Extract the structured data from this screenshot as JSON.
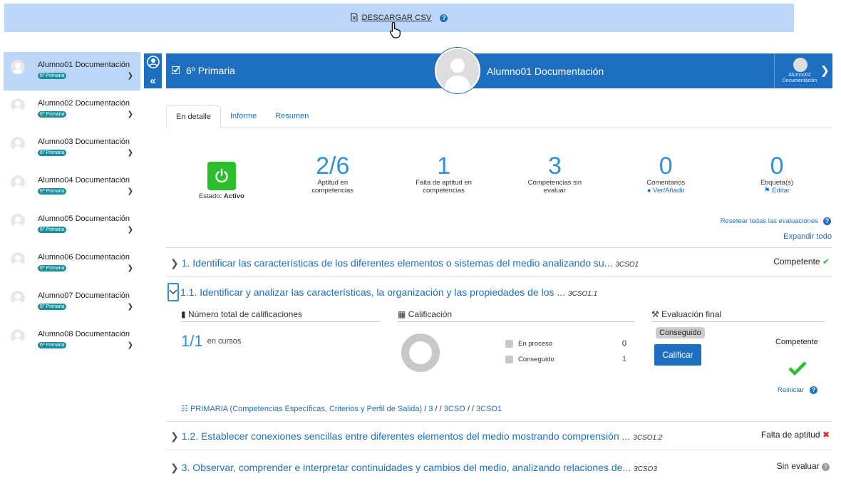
{
  "top": {
    "download_label": "DESCARGAR CSV"
  },
  "sidebar": {
    "items": [
      {
        "name": "Alumno01 Documentación",
        "badge": "6º Primaria"
      },
      {
        "name": "Alumno02 Documentación",
        "badge": "6º Primaria"
      },
      {
        "name": "Alumno03 Documentación",
        "badge": "6º Primaria"
      },
      {
        "name": "Alumno04 Documentación",
        "badge": "6º Primaria"
      },
      {
        "name": "Alumno05 Documentación",
        "badge": "6º Primaria"
      },
      {
        "name": "Alumno06 Documentación",
        "badge": "6º Primaria"
      },
      {
        "name": "Alumno07 Documentación",
        "badge": "6º Primaria"
      },
      {
        "name": "Alumno08 Documentación",
        "badge": "6º Primaria"
      }
    ]
  },
  "header": {
    "course": "6º Primaria",
    "student": "Alumno01 Documentación",
    "next_student_line1": "Alumno02",
    "next_student_line2": "Documentación"
  },
  "tabs": [
    "En detalle",
    "Informe",
    "Resumen"
  ],
  "stats": {
    "state_label": "Estado:",
    "state_value": "Activo",
    "aptitude_value": "2/6",
    "aptitude_label": "Aptitud en competencias",
    "lack_value": "1",
    "lack_label": "Falta de aptitud en competencias",
    "uneval_value": "3",
    "uneval_label": "Competencias sin evaluar",
    "comments_value": "0",
    "comments_label": "Comentarios",
    "comments_link": "Ver/Añadir",
    "tags_value": "0",
    "tags_label": "Etiqueta(s)",
    "tags_link": "Editar"
  },
  "actions": {
    "reset_all": "Resetear todas las evaluaciones",
    "expand_all": "Expandir todo"
  },
  "competencies": [
    {
      "title": "1. Identificar las características de los diferentes elementos o sistemas del medio analizando su...",
      "code": "3CSO1",
      "status": "Competente"
    },
    {
      "title": "1.1. Identificar y analizar las características, la organización y las propiedades de los ...",
      "code": "3CSO1.1"
    },
    {
      "title": "1.2. Establecer conexiones sencillas entre diferentes elementos del medio mostrando comprensión ...",
      "code": "3CSO1.2",
      "status": "Falta de aptitud"
    },
    {
      "title": "3. Observar, comprender e interpretar continuidades y cambios del medio, analizando relaciones de...",
      "code": "3CSO3",
      "status": "Sin evaluar"
    }
  ],
  "detail": {
    "ratings_title": "Número total de calificaciones",
    "ratings_value": "1/1",
    "ratings_suffix": "en cursos",
    "grade_title": "Calificación",
    "legend": [
      {
        "label": "En proceso",
        "value": "0"
      },
      {
        "label": "Conseguido",
        "value": "1"
      }
    ],
    "final_title": "Evaluación final",
    "final_tag": "Conseguido",
    "rate_button": "Calificar",
    "final_status": "Competente",
    "reset_link": "Reiniciar",
    "breadcrumb": [
      "PRIMARIA (Competencias Específicas, Criterios y Perfil de Salida)",
      "3",
      "3CSO",
      "3CSO1"
    ]
  },
  "colors": {
    "primary": "#1e6fc0",
    "highlight": "#bcd6f7",
    "success": "#2bbf2b",
    "danger": "#d22222"
  }
}
